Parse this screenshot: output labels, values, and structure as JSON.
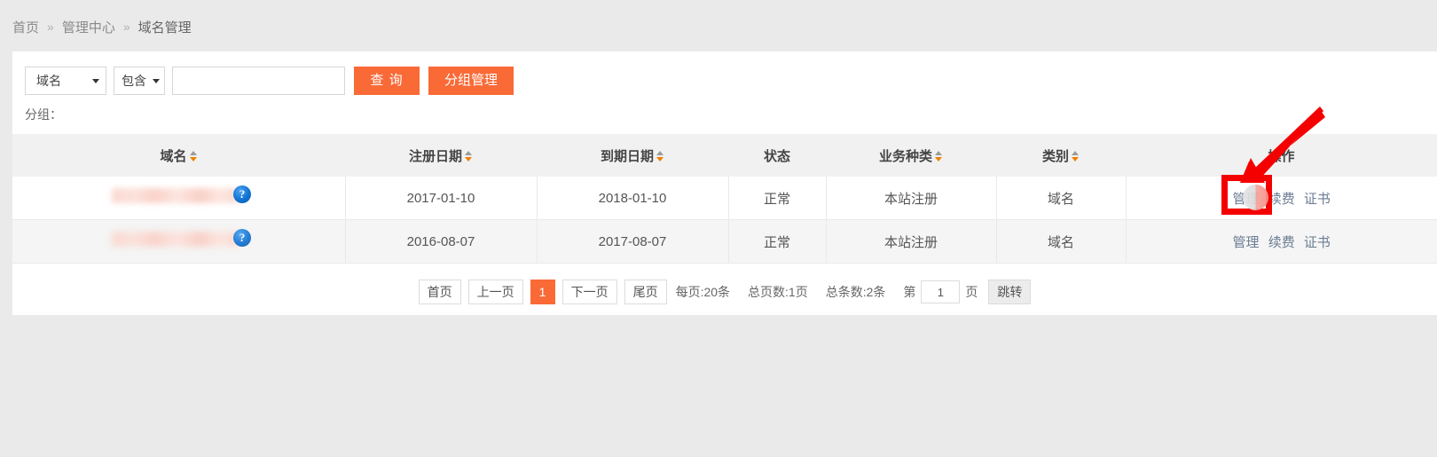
{
  "breadcrumb": {
    "separator": "»",
    "items": [
      {
        "label": "首页"
      },
      {
        "label": "管理中心"
      },
      {
        "label": "域名管理"
      }
    ]
  },
  "toolbar": {
    "field_select": {
      "value": "域名",
      "icon": "chevron-down-icon"
    },
    "match_select": {
      "value": "包含",
      "icon": "chevron-down-icon"
    },
    "keyword_input": {
      "value": "",
      "placeholder": ""
    },
    "search_button": "查 询",
    "group_manage_button": "分组管理",
    "group_label": "分组："
  },
  "table": {
    "columns": [
      {
        "label": "域名",
        "sortable": true
      },
      {
        "label": "注册日期",
        "sortable": true
      },
      {
        "label": "到期日期",
        "sortable": true
      },
      {
        "label": "状态",
        "sortable": false
      },
      {
        "label": "业务种类",
        "sortable": true
      },
      {
        "label": "类别",
        "sortable": true
      },
      {
        "label": "操作",
        "sortable": false
      }
    ],
    "rows": [
      {
        "domain": "",
        "domain_redacted": true,
        "help_icon": "question-help-icon",
        "register_date": "2017-01-10",
        "expire_date": "2018-01-10",
        "status": "正常",
        "business_type": "本站注册",
        "category": "域名",
        "ops": [
          "管理",
          "续费",
          "证书"
        ]
      },
      {
        "domain": "",
        "domain_redacted": true,
        "help_icon": "question-help-icon",
        "register_date": "2016-08-07",
        "expire_date": "2017-08-07",
        "status": "正常",
        "business_type": "本站注册",
        "category": "域名",
        "ops": [
          "管理",
          "续费",
          "证书"
        ]
      }
    ]
  },
  "pagination": {
    "first": "首页",
    "prev": "上一页",
    "current_page": "1",
    "next": "下一页",
    "last": "尾页",
    "per_page_info": "每页:20条",
    "total_pages_info": "总页数:1页",
    "total_records_info": "总条数:2条",
    "jump_prefix": "第",
    "jump_value": "1",
    "jump_suffix": "页",
    "jump_button": "跳转"
  },
  "annotations": {
    "highlight_color": "#f40000",
    "arrow": "red-arrow-annotation",
    "box": "red-highlight-box",
    "cursor": "mouse-cursor-indicator"
  },
  "colors": {
    "accent": "#f96a37",
    "page_bg": "#eaeaea",
    "header_bg": "#f1f1f1",
    "stripe_bg": "#f5f5f5"
  }
}
